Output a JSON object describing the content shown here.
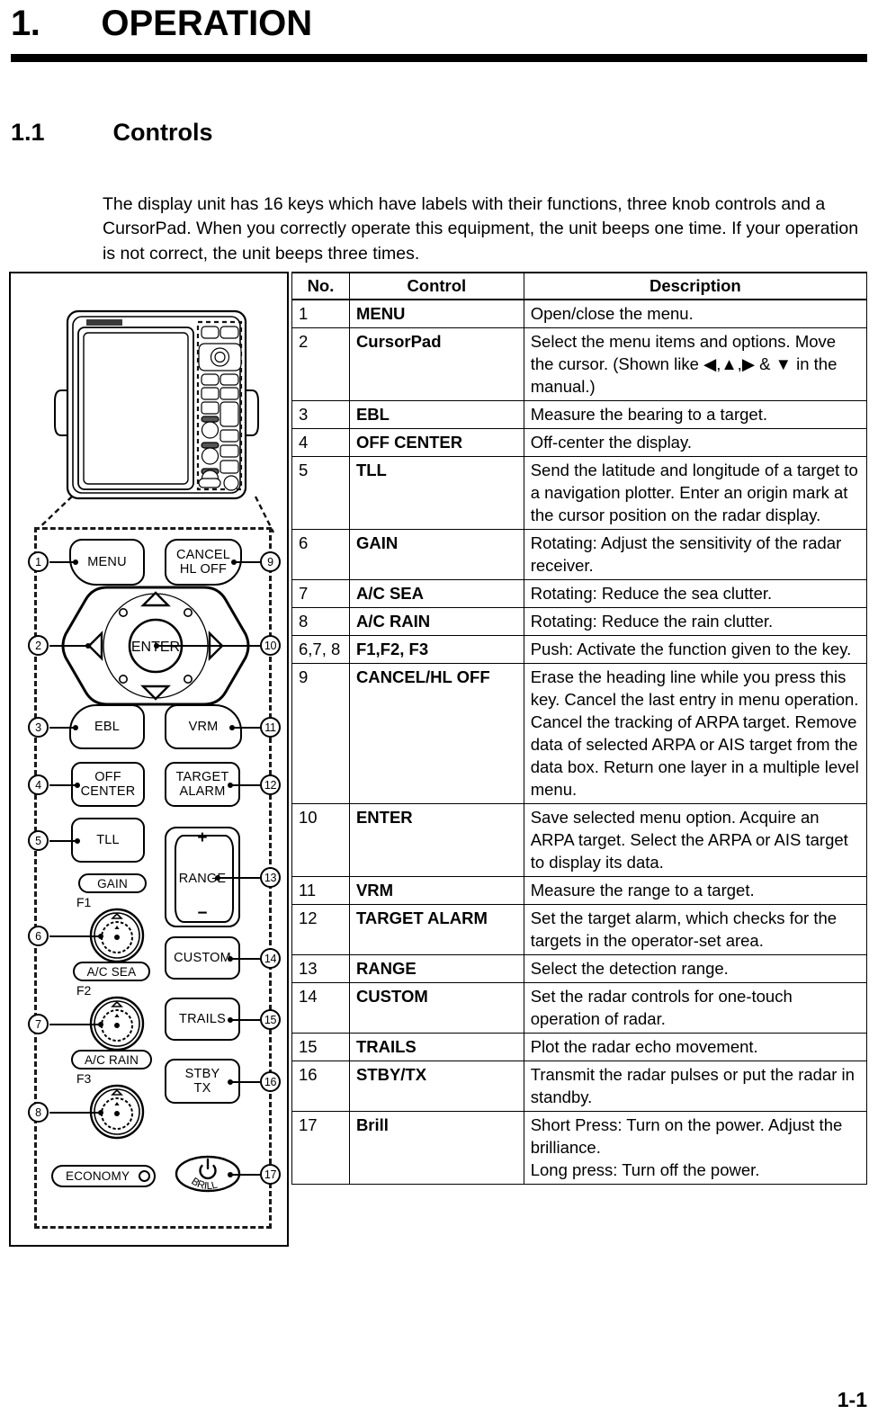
{
  "chapter": {
    "number": "1.",
    "title": "OPERATION"
  },
  "section": {
    "number": "1.1",
    "title": "Controls"
  },
  "intro": "The display unit has 16 keys which have labels with their functions, three knob controls and a CursorPad. When you correctly operate this equipment, the unit beeps one time. If your operation is not correct, the unit beeps three times.",
  "page_number": "1-1",
  "table": {
    "headers": {
      "no": "No.",
      "control": "Control",
      "description": "Description"
    },
    "rows": [
      {
        "no": "1",
        "control": "MENU",
        "description": "Open/close the menu."
      },
      {
        "no": "2",
        "control": "CursorPad",
        "description": "Select the menu items and options. Move the cursor. (Shown like ◀,▲,▶ & ▼ in the manual.)"
      },
      {
        "no": "3",
        "control": "EBL",
        "description": "Measure the bearing to a target."
      },
      {
        "no": "4",
        "control": "OFF CENTER",
        "description": "Off-center the display."
      },
      {
        "no": "5",
        "control": "TLL",
        "description": "Send the latitude and longitude of a target to a navigation plotter. Enter an origin mark at the cursor position on the radar display."
      },
      {
        "no": "6",
        "control": "GAIN",
        "description": "Rotating: Adjust the sensitivity of the radar receiver."
      },
      {
        "no": "7",
        "control": "A/C SEA",
        "description": "Rotating: Reduce the sea clutter."
      },
      {
        "no": "8",
        "control": "A/C RAIN",
        "description": "Rotating: Reduce the rain clutter."
      },
      {
        "no": "6,7, 8",
        "control": "F1,F2, F3",
        "description": "Push: Activate the function given to the key."
      },
      {
        "no": "9",
        "control": "CANCEL/HL OFF",
        "description": "Erase the heading line while you press this key. Cancel the last entry in menu operation. Cancel the tracking of ARPA target. Remove data of selected ARPA or AIS target from the data box. Return one layer in a multiple level menu."
      },
      {
        "no": "10",
        "control": "ENTER",
        "description": "Save selected menu option. Acquire an ARPA target. Select the ARPA or AIS target to display its data."
      },
      {
        "no": "11",
        "control": "VRM",
        "description": "Measure the range to a target."
      },
      {
        "no": "12",
        "control": "TARGET ALARM",
        "description": "Set the target alarm, which checks for the targets in the operator-set area."
      },
      {
        "no": "13",
        "control": "RANGE",
        "description": "Select the detection range."
      },
      {
        "no": "14",
        "control": "CUSTOM",
        "description": "Set the radar controls for one-touch operation of radar."
      },
      {
        "no": "15",
        "control": "TRAILS",
        "description": "Plot the radar echo movement."
      },
      {
        "no": "16",
        "control": "STBY/TX",
        "description": "Transmit the radar pulses or put the radar in standby."
      },
      {
        "no": "17",
        "control": "Brill",
        "description": "Short Press: Turn on the power. Adjust the brilliance.\nLong press: Turn off the power."
      }
    ]
  },
  "figure": {
    "keys": {
      "menu": "MENU",
      "cancel_line1": "CANCEL",
      "cancel_line2": "HL OFF",
      "enter": "ENTER",
      "ebl": "EBL",
      "vrm": "VRM",
      "off_center_line1": "OFF",
      "off_center_line2": "CENTER",
      "target_alarm_line1": "TARGET",
      "target_alarm_line2": "ALARM",
      "tll": "TLL",
      "range": "RANGE",
      "range_plus": "+",
      "range_minus": "−",
      "custom": "CUSTOM",
      "trails": "TRAILS",
      "stby_line1": "STBY",
      "stby_line2": "TX",
      "brill": "BRILL"
    },
    "labels": {
      "gain": "GAIN",
      "ac_sea": "A/C SEA",
      "ac_rain": "A/C RAIN",
      "economy": "ECONOMY",
      "f1": "F1",
      "f2": "F2",
      "f3": "F3"
    },
    "callouts": {
      "c1": "1",
      "c2": "2",
      "c3": "3",
      "c4": "4",
      "c5": "5",
      "c6": "6",
      "c7": "7",
      "c8": "8",
      "c9": "9",
      "c10": "10",
      "c11": "11",
      "c12": "12",
      "c13": "13",
      "c14": "14",
      "c15": "15",
      "c16": "16",
      "c17": "17"
    }
  }
}
